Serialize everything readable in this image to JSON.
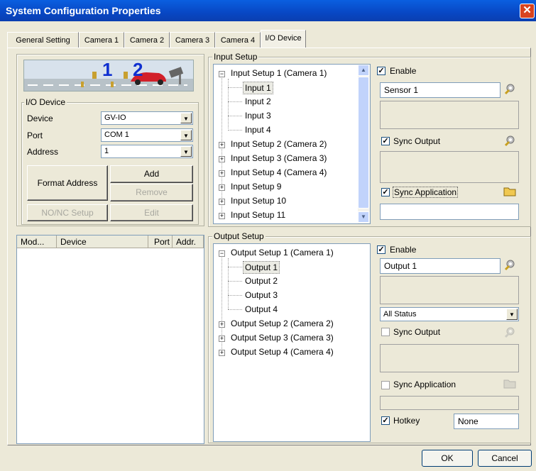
{
  "window": {
    "title": "System Configuration Properties",
    "close_glyph": "✕"
  },
  "tabs": [
    {
      "label": "General Setting"
    },
    {
      "label": "Camera 1"
    },
    {
      "label": "Camera 2"
    },
    {
      "label": "Camera 3"
    },
    {
      "label": "Camera 4"
    },
    {
      "label": "I/O Device"
    }
  ],
  "banner": {
    "marker1": "1",
    "marker2": "2"
  },
  "io_device": {
    "legend": "I/O Device",
    "device_label": "Device",
    "device_value": "GV-IO",
    "port_label": "Port",
    "port_value": "COM 1",
    "address_label": "Address",
    "address_value": "1",
    "format_address": "Format Address",
    "add": "Add",
    "remove": "Remove",
    "nonc_setup": "NO/NC Setup",
    "edit": "Edit"
  },
  "device_table": {
    "columns": [
      "Mod...",
      "Device",
      "Port",
      "Addr."
    ]
  },
  "input_setup": {
    "legend": "Input Setup",
    "tree": [
      {
        "label": "Input Setup 1 (Camera 1)",
        "expanded": true,
        "children": [
          "Input 1",
          "Input 2",
          "Input 3",
          "Input 4"
        ]
      },
      {
        "label": "Input Setup 2 (Camera 2)"
      },
      {
        "label": "Input Setup 3 (Camera 3)"
      },
      {
        "label": "Input Setup 4 (Camera 4)"
      },
      {
        "label": "Input Setup 9"
      },
      {
        "label": "Input Setup 10"
      },
      {
        "label": "Input Setup 11"
      }
    ],
    "selected": "Input 1",
    "enable_label": "Enable",
    "enable_checked": true,
    "name_value": "Sensor 1",
    "sync_output_label": "Sync Output",
    "sync_output_checked": true,
    "sync_application_label": "Sync Application",
    "sync_application_checked": true
  },
  "output_setup": {
    "legend": "Output Setup",
    "tree": [
      {
        "label": "Output Setup 1 (Camera 1)",
        "expanded": true,
        "children": [
          "Output 1",
          "Output 2",
          "Output 3",
          "Output 4"
        ]
      },
      {
        "label": "Output Setup 2 (Camera 2)"
      },
      {
        "label": "Output Setup 3 (Camera 3)"
      },
      {
        "label": "Output Setup 4 (Camera 4)"
      }
    ],
    "selected": "Output 1",
    "enable_label": "Enable",
    "enable_checked": true,
    "name_value": "Output 1",
    "status_value": "All Status",
    "sync_output_label": "Sync Output",
    "sync_output_checked": false,
    "sync_application_label": "Sync Application",
    "sync_application_checked": false,
    "hotkey_label": "Hotkey",
    "hotkey_checked": true,
    "hotkey_value": "None"
  },
  "footer": {
    "ok": "OK",
    "cancel": "Cancel"
  },
  "glyphs": {
    "check": "✓",
    "plus": "+",
    "minus": "−",
    "down": "▼",
    "up": "▲"
  }
}
